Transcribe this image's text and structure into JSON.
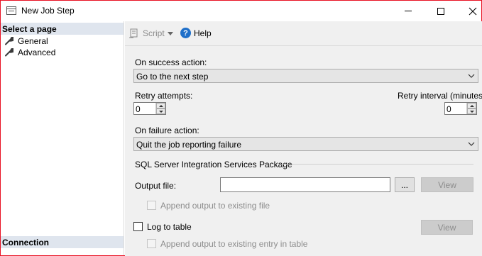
{
  "window": {
    "title": "New Job Step",
    "buttons": {
      "minimize": "minimize",
      "maximize": "maximize",
      "close": "close"
    }
  },
  "left_pane": {
    "select_page_header": "Select a page",
    "items": [
      {
        "label": "General",
        "icon": "wrench-icon"
      },
      {
        "label": "Advanced",
        "icon": "wrench-icon"
      }
    ],
    "connection_header": "Connection"
  },
  "toolbar": {
    "script_label": "Script",
    "help_label": "Help",
    "help_glyph": "?"
  },
  "form": {
    "on_success_label": "On success action:",
    "on_success_value": "Go to the next step",
    "retry_attempts_label": "Retry attempts:",
    "retry_attempts_value": "0",
    "retry_interval_label": "Retry interval (minutes):",
    "retry_interval_value": "0",
    "on_failure_label": "On failure action:",
    "on_failure_value": "Quit the job reporting failure",
    "ssis_group_label": "SQL Server Integration Services Package",
    "output_file_label": "Output file:",
    "output_file_value": "",
    "browse_label": "...",
    "view_label": "View",
    "append_output_label": "Append output to existing file",
    "log_to_table_label": "Log to table",
    "log_view_label": "View",
    "append_entry_label": "Append output to existing entry in table"
  },
  "colors": {
    "window_border": "#e81123",
    "section_header_bg": "#dfe5ee",
    "pane_bg": "#f0f0f0",
    "help_blue": "#1e6fc9"
  }
}
